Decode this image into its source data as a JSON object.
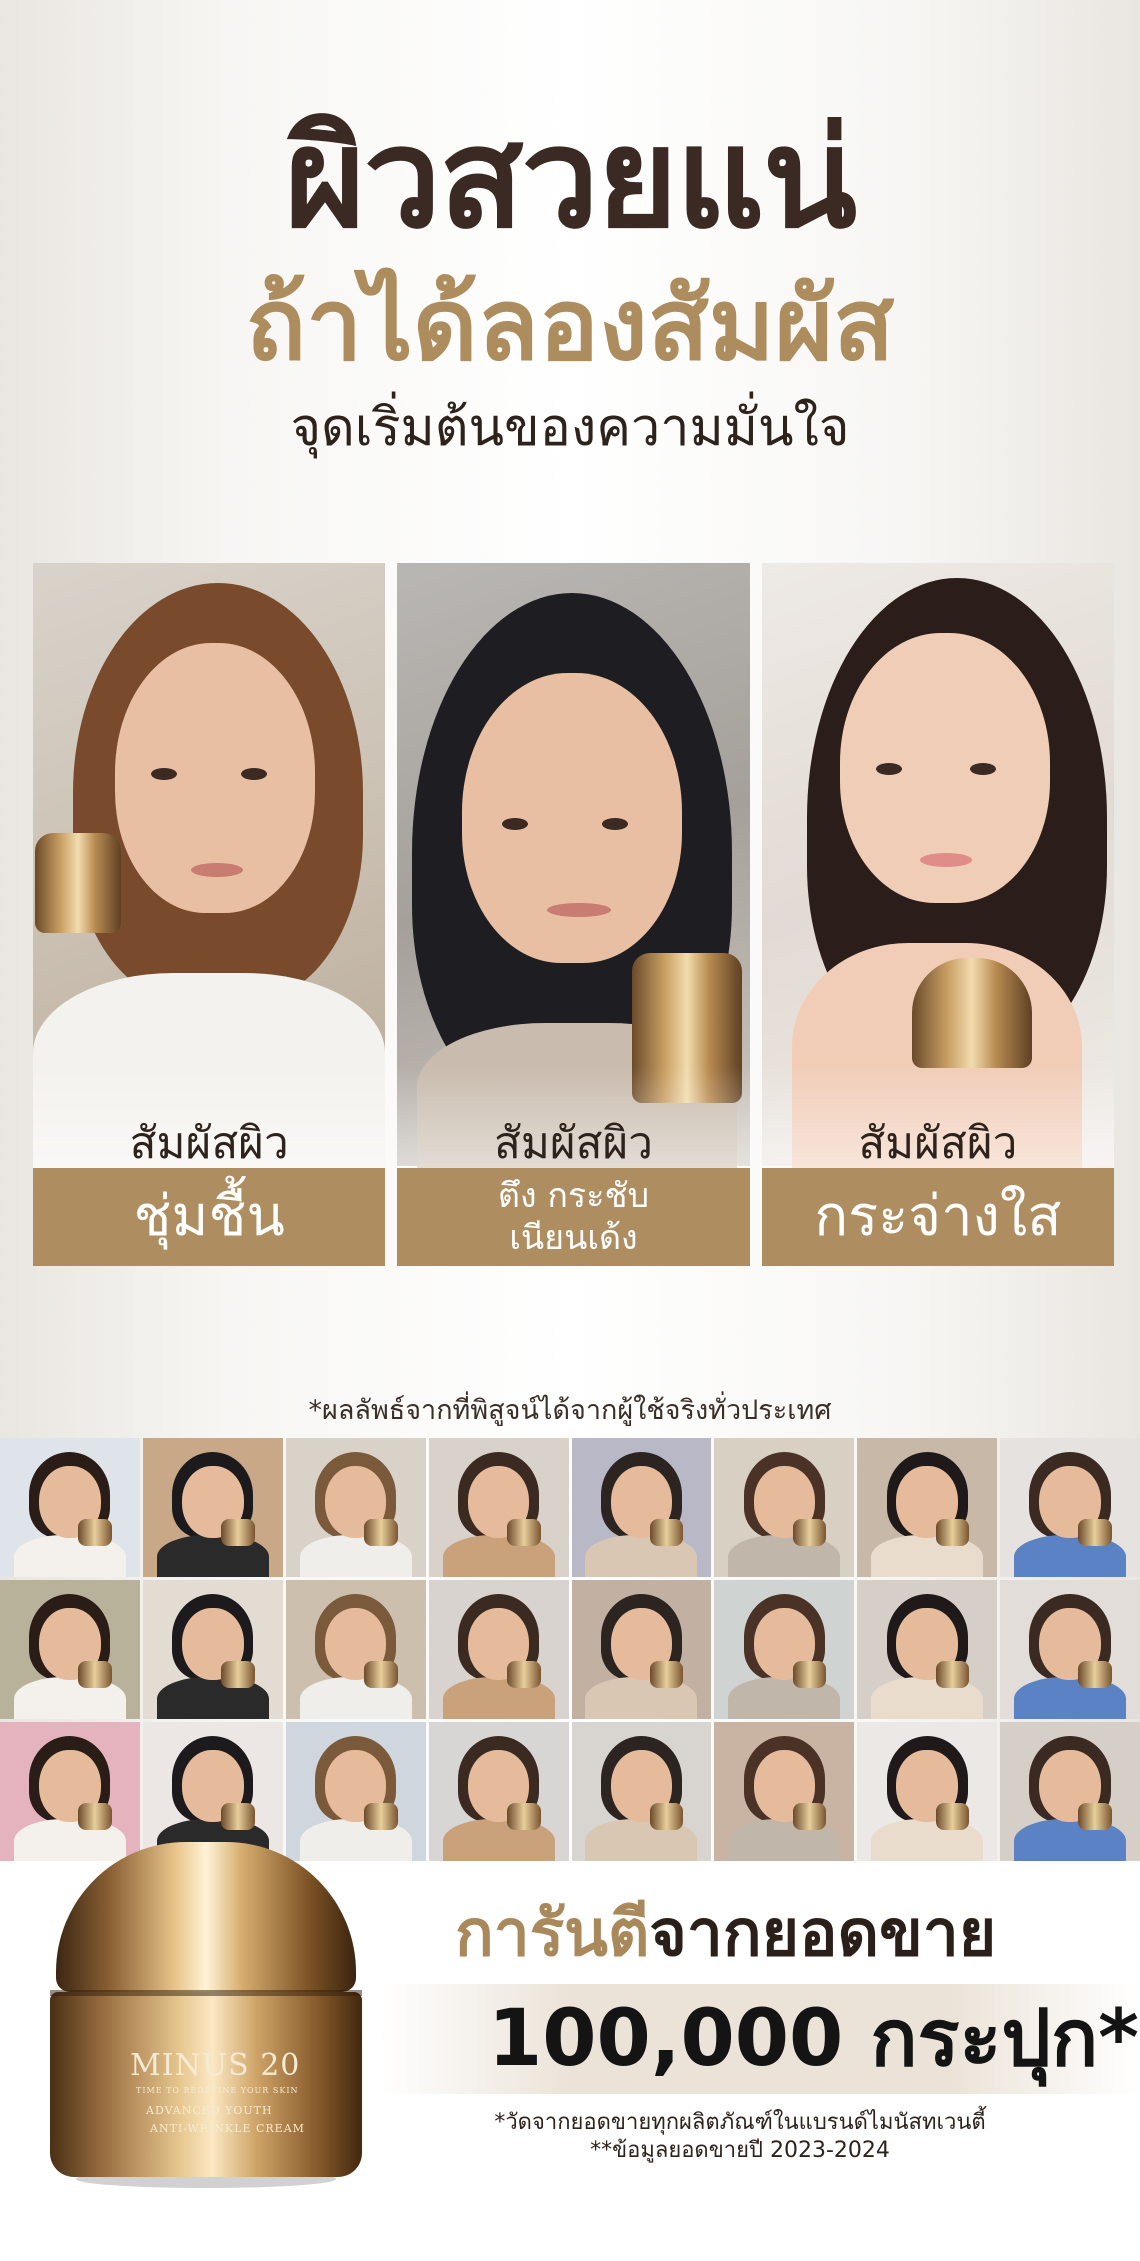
{
  "headline": {
    "line1": "ผิวสวยแน่",
    "line2": "ถ้าได้ลองสัมผัส",
    "line3": "จุดเริ่มต้นของความมั่นใจ"
  },
  "cards": [
    {
      "label": "สัมผัสผิว",
      "band_lines": [
        "ชุ่มชื้น"
      ]
    },
    {
      "label": "สัมผัสผิว",
      "band_lines": [
        "ตึง กระชับ",
        "เนียนเด้ง"
      ]
    },
    {
      "label": "สัมผัสผิว",
      "band_lines": [
        "กระจ่างใส"
      ]
    }
  ],
  "disclaimer": "*ผลลัพธ์จากที่พิสูจน์ได้จากผู้ใช้จริงทั่วประเทศ",
  "guarantee": {
    "gold_text": "การันตี",
    "dark_text": "จากยอดขาย",
    "sales": "100,000 กระปุก**",
    "note1": "*วัดจากยอดขายทุกผลิตภัณฑ์ในแบรนด์ไมนัสทเวนตี้",
    "note2": "**ข้อมูลยอดขายปี 2023-2024"
  },
  "product": {
    "brand": "MINUS 20",
    "tagline": "TIME TO REDEFINE YOUR SKIN",
    "line1": "ADVANCED YOUTH",
    "line2": "ANTI-WRINKLE CREAM"
  },
  "colors": {
    "brand_gold": "#ae8d61",
    "headline_dark": "#3b2a24",
    "headline_gold": "#ad8d5e"
  }
}
